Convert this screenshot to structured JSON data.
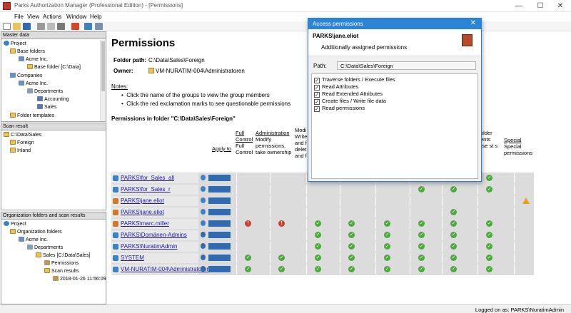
{
  "window": {
    "title": "Parks Authorization Manager (Professional Edition) - [Permissions]"
  },
  "menu": [
    "File",
    "View",
    "Actions",
    "Window",
    "Help"
  ],
  "panes": {
    "master": {
      "title": "Master data",
      "items": [
        "Project",
        "Base folders",
        "Acme Inc.",
        "Base folder [C:\\Data]",
        "Companies",
        "Acme Inc.",
        "Departments",
        "Accounting",
        "Sales",
        "Folder templates"
      ]
    },
    "scan": {
      "title": "Scan result",
      "items": [
        "C:\\Data\\Sales",
        "Foreign",
        "Inland"
      ]
    },
    "org": {
      "title": "Organization folders and scan results",
      "items": [
        "Project",
        "Organization folders",
        "Acme Inc.",
        "Departments",
        "Sales [C:\\Data\\Sales]",
        "Permissions",
        "Scan results",
        "2018-01-26 11:56:09"
      ]
    }
  },
  "main": {
    "heading": "Permissions",
    "folder_path_label": "Folder path:",
    "folder_path": "C:\\Data\\Sales\\Foreign",
    "owner_label": "Owner:",
    "owner": "VM-NURATIM-004\\Administratoren",
    "notes_label": "Notes:",
    "notes": [
      "Click the name of the groups to view the group members",
      "Click the red exclamation marks to see questionable permissions"
    ],
    "table_title": "Permissions in folder \"C:\\Data\\Sales\\Foreign\"",
    "columns": {
      "apply_to": "Apply to",
      "full_control": {
        "title": "Full Control",
        "desc": "Full Control"
      },
      "administration": {
        "title": "Administration",
        "desc": "Modify permissions, take ownership"
      },
      "modify_partial": "Modi Write and f delet and f",
      "folder_partial": "older ents rse st s",
      "special": {
        "title": "Special",
        "desc": "Special permissions"
      }
    },
    "rows": [
      {
        "name": "PARKS\\for_Sales_all"
      },
      {
        "name": "PARKS\\for_Sales_r"
      },
      {
        "name": "PARKS\\jane.eliot"
      },
      {
        "name": "PARKS\\jane.eliot"
      },
      {
        "name": "PARKS\\marc.miller"
      },
      {
        "name": "PARKS\\Domänen-Admins"
      },
      {
        "name": "PARKS\\NuratimAdmin"
      },
      {
        "name": "SYSTEM"
      },
      {
        "name": "VM-NURATIM-004\\Administratoren"
      }
    ]
  },
  "dialog": {
    "title": "Access permissions",
    "user": "PARKS\\jane.eliot",
    "subtitle": "Additionally assigned permissions",
    "path_label": "Path:",
    "path": "C:\\Data\\Sales\\Foreign",
    "permissions": [
      "Traverse folders / Execute files",
      "Read Attributes",
      "Read Extended Attributes",
      "Create files / Write file data",
      "Read permissions"
    ]
  },
  "status": {
    "logged_on": "Logged on as: PARKS\\NuratimAdmin"
  },
  "colors": {
    "ok": "#4caa3a",
    "bad": "#d43b2a",
    "warn": "#e5a21a",
    "accent": "#2b84d6"
  }
}
